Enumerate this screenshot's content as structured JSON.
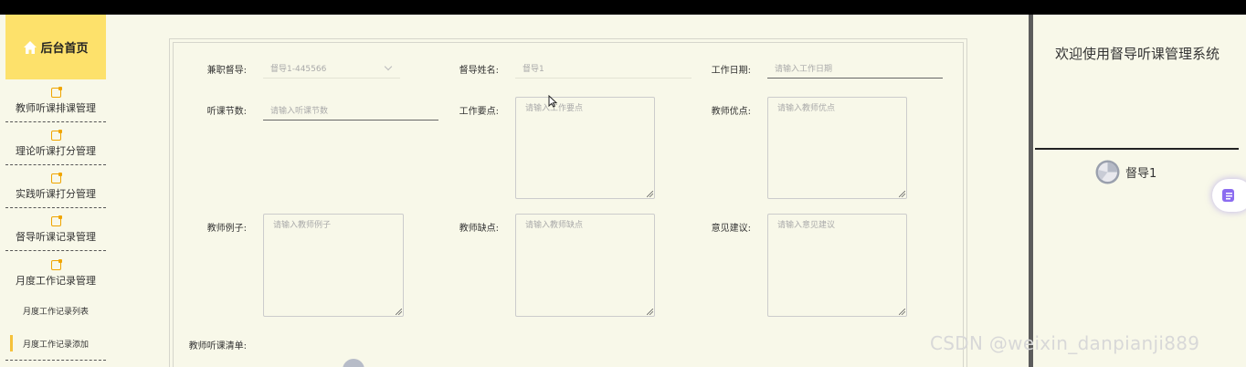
{
  "sidebar": {
    "home_label": "后台首页",
    "items": [
      {
        "label": "教师听课排课管理",
        "icon": "note-icon"
      },
      {
        "label": "理论听课打分管理",
        "icon": "note-icon"
      },
      {
        "label": "实践听课打分管理",
        "icon": "note-icon"
      },
      {
        "label": "督导听课记录管理",
        "icon": "note-icon"
      },
      {
        "label": "月度工作记录管理",
        "icon": "note-icon"
      }
    ],
    "sub_items": [
      {
        "label": "月度工作记录列表"
      },
      {
        "label": "月度工作记录添加",
        "active": true
      }
    ]
  },
  "form": {
    "supervisor": {
      "label": "兼职督导:",
      "value": "督导1-445566"
    },
    "supervisor_name": {
      "label": "督导姓名:",
      "value": "督导1"
    },
    "work_date": {
      "label": "工作日期:",
      "placeholder": "请输入工作日期"
    },
    "lesson_count": {
      "label": "听课节数:",
      "placeholder": "请输入听课节数"
    },
    "work_points": {
      "label": "工作要点:",
      "placeholder": "请输入工作要点"
    },
    "teacher_strengths": {
      "label": "教师优点:",
      "placeholder": "请输入教师优点"
    },
    "teacher_examples": {
      "label": "教师例子:",
      "placeholder": "请输入教师例子"
    },
    "teacher_weaknesses": {
      "label": "教师缺点:",
      "placeholder": "请输入教师缺点"
    },
    "suggestions": {
      "label": "意见建议:",
      "placeholder": "请输入意见建议"
    },
    "lesson_list": {
      "label": "教师听课清单:"
    }
  },
  "header": {
    "welcome": "欢迎使用督导听课管理系统",
    "user_name": "督导1"
  },
  "watermark": "CSDN @weixin_danpianji889",
  "colors": {
    "accent": "#fde16b",
    "background": "#f8f8e9",
    "active_marker": "#f5c13a"
  }
}
